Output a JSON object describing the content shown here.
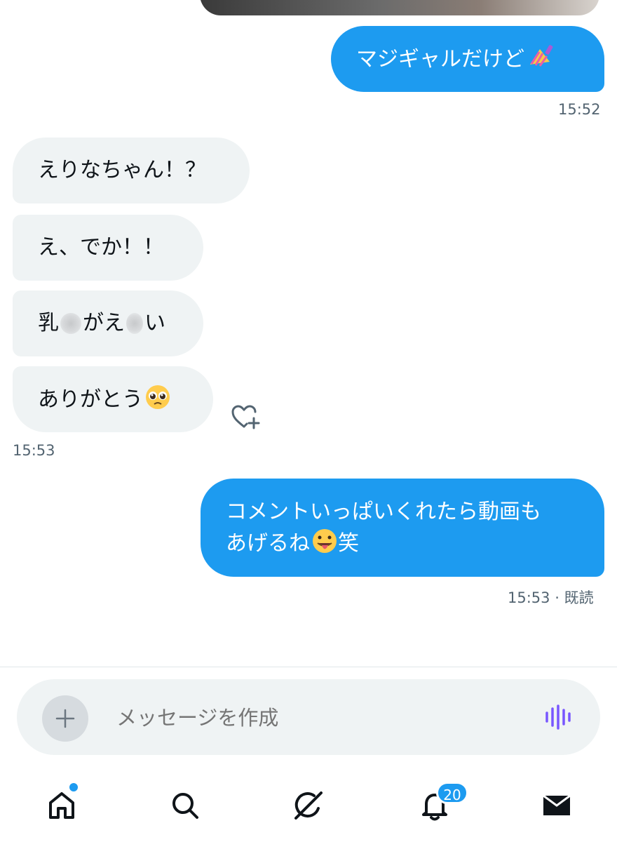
{
  "messages": [
    {
      "direction": "outgoing",
      "text": "マジギャルだけど",
      "emoji": "nail-polish",
      "time": "15:52"
    },
    {
      "direction": "incoming",
      "text": "えりなちゃん！？"
    },
    {
      "direction": "incoming",
      "text": "え、でか！！"
    },
    {
      "direction": "incoming",
      "text_parts": [
        "乳",
        "がえ",
        "い"
      ],
      "note_blurred": true
    },
    {
      "direction": "incoming",
      "text": "ありがとう",
      "emoji": "pleading-face",
      "time": "15:53"
    },
    {
      "direction": "outgoing",
      "line1": "コメントいっぱいくれたら動画も",
      "line2_a": "あげるね",
      "emoji": "tongue-face",
      "line2_b": "笑",
      "time": "15:53",
      "read_status": "· 既読"
    }
  ],
  "composer": {
    "placeholder": "メッセージを作成"
  },
  "nav": {
    "items": [
      "home-icon",
      "search-icon",
      "grok-icon",
      "notifications-icon",
      "messages-icon"
    ],
    "notification_count": "20"
  },
  "colors": {
    "accent": "#1d9bf0",
    "incoming_bg": "#eff3f4",
    "voice": "#7856ff"
  }
}
